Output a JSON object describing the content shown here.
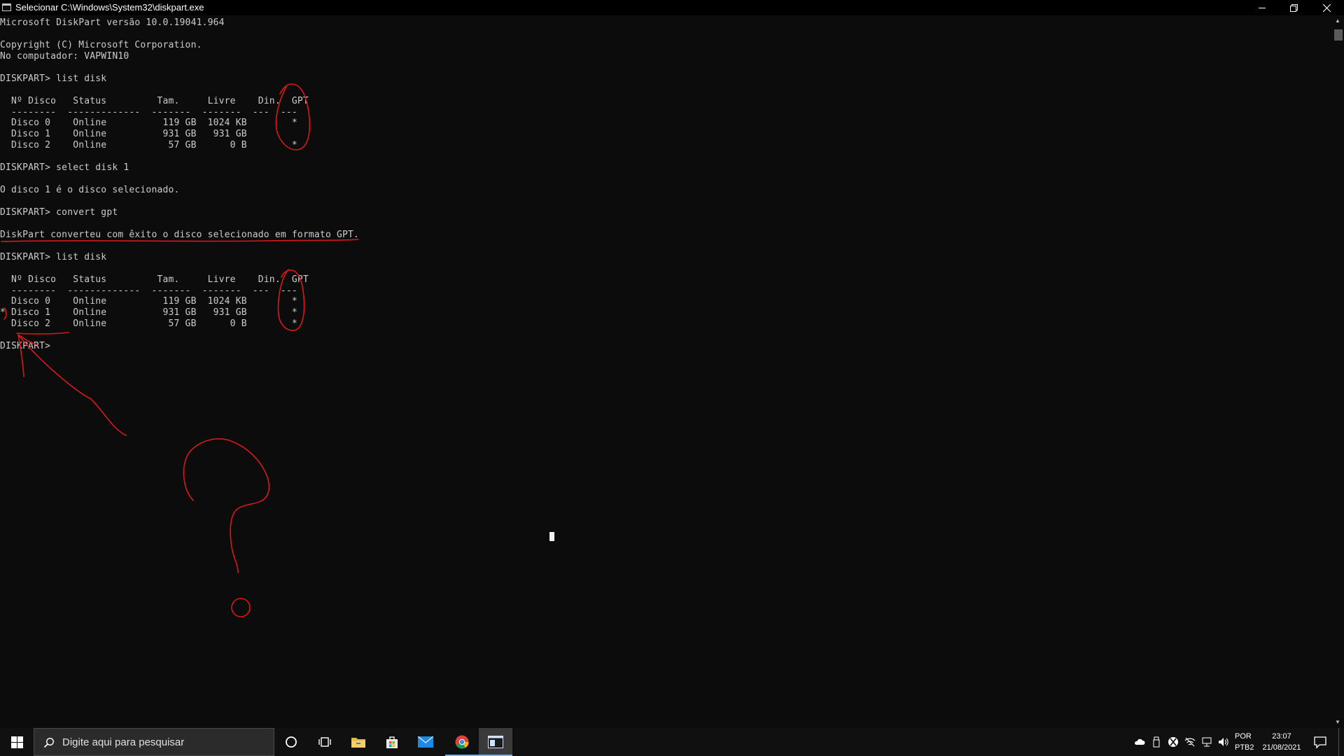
{
  "window": {
    "title": "Selecionar C:\\Windows\\System32\\diskpart.exe",
    "icon": "console-window-icon"
  },
  "console": {
    "lines": [
      "Microsoft DiskPart versão 10.0.19041.964",
      "",
      "Copyright (C) Microsoft Corporation.",
      "No computador: VAPWIN10",
      "",
      "DISKPART> list disk",
      "",
      "  Nº Disco   Status         Tam.     Livre    Din.  GPT",
      "  --------  -------------  -------  -------  ---  ---",
      "  Disco 0    Online          119 GB  1024 KB        *",
      "  Disco 1    Online          931 GB   931 GB",
      "  Disco 2    Online           57 GB      0 B        *",
      "",
      "DISKPART> select disk 1",
      "",
      "O disco 1 é o disco selecionado.",
      "",
      "DISKPART> convert gpt",
      "",
      "DiskPart converteu com êxito o disco selecionado em formato GPT.",
      "",
      "DISKPART> list disk",
      "",
      "  Nº Disco   Status         Tam.     Livre    Din.  GPT",
      "  --------  -------------  -------  -------  ---  ---",
      "  Disco 0    Online          119 GB  1024 KB        *",
      "* Disco 1    Online          931 GB   931 GB        *",
      "  Disco 2    Online           57 GB      0 B        *",
      "",
      "DISKPART>"
    ],
    "annotation_color": "#d81818"
  },
  "taskbar": {
    "search_placeholder": "Digite aqui para pesquisar",
    "apps": [
      "cortana-icon",
      "task-view-icon",
      "file-explorer-icon",
      "microsoft-store-icon",
      "mail-icon",
      "chrome-icon",
      "console-window-icon"
    ],
    "active_app": "console-window-icon",
    "tray_icons": [
      "onedrive-icon",
      "usb-icon",
      "xbox-icon",
      "network-off-icon",
      "network-icon",
      "volume-icon"
    ],
    "language": "POR",
    "keyboard": "PTB2",
    "time": "23:07",
    "date": "21/08/2021"
  }
}
